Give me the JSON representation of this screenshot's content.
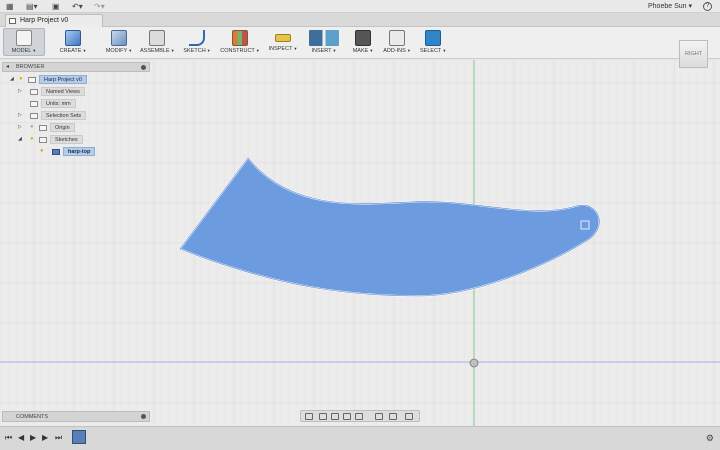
{
  "window": {
    "document_tab": "Harp Project v0",
    "user_name": "Phoebe Sun",
    "help_label": "?"
  },
  "toolbar": {
    "tools": [
      {
        "label": "MODEL",
        "icon": "model-workspace-icon"
      },
      {
        "label": "CREATE",
        "icon": "box-icon"
      },
      {
        "label": "MODIFY",
        "icon": "modify-icon"
      },
      {
        "label": "ASSEMBLE",
        "icon": "joint-icon"
      },
      {
        "label": "SKETCH",
        "icon": "sketch-icon"
      },
      {
        "label": "CONSTRUCT",
        "icon": "plane-icon"
      },
      {
        "label": "INSPECT",
        "icon": "ruler-icon"
      },
      {
        "label": "INSERT",
        "icon": "insert-image-icon"
      },
      {
        "label": "MAKE",
        "icon": "3d-print-icon"
      },
      {
        "label": "ADD-INS",
        "icon": "scripts-icon"
      },
      {
        "label": "SELECT",
        "icon": "select-icon"
      }
    ]
  },
  "viewcube": {
    "label": "RIGHT"
  },
  "browser": {
    "title": "BROWSER",
    "nodes": [
      {
        "label": "Harp Project v0",
        "selected": true
      },
      {
        "label": "Named Views"
      },
      {
        "label": "Units: mm"
      },
      {
        "label": "Selection Sets"
      },
      {
        "label": "Origin"
      },
      {
        "label": "Sketches"
      },
      {
        "label": "harp-top",
        "selected": true
      }
    ]
  },
  "comments": {
    "title": "COMMENTS"
  },
  "colors": {
    "profile_fill": "#6d9be0",
    "profile_stroke": "#ffffff",
    "grid_line": "#dadada",
    "axis_green": "#5cbf6a",
    "axis_blue": "#8f9be6",
    "accent": "#2e85c8"
  }
}
